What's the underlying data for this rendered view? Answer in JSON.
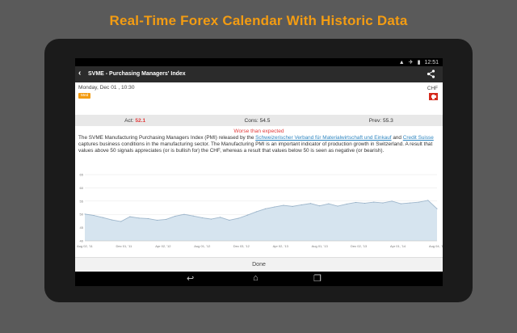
{
  "promo": {
    "title": "Real-Time Forex Calendar With Historic Data"
  },
  "status_bar": {
    "time": "12:51"
  },
  "action_bar": {
    "title": "SVME - Purchasing Managers' Index"
  },
  "event": {
    "date": "Monday, Dec 01 , 10:30",
    "badge": "Med",
    "currency": "CHF",
    "actual_label": "Act:",
    "actual_value": "52.1",
    "consensus_label": "Cons: 54.5",
    "previous_label": "Prev: 55.3",
    "verdict": "Worse than expected",
    "description_pre": "The SVME Manufacturing Purchasing Managers Index (PMI) released by the ",
    "link1": "Schweizerischer Verband für Materialwirtschaft und Einkauf",
    "description_mid": " and ",
    "link2": "Credit Suisse",
    "description_post": " captures business conditions in the manufacturing sector. The Manufacturing PMI is an important indicator of production growth in Switzerland. A result that values above 50 signals appreciates (or is bullish for) the CHF, whereas a result that values below 50 is seen as negative (or bearish)."
  },
  "done_label": "Done",
  "chart_data": {
    "type": "area",
    "x_labels": [
      "Aug 02, '11",
      "Dec 01, '11",
      "Apr 02, '12",
      "Aug 01, '12",
      "Dec 03, '12",
      "Apr 02, '13",
      "Aug 01, '13",
      "Dec 02, '13",
      "Apr 01, '14",
      "Aug 04, '14"
    ],
    "yticks": [
      40,
      45,
      50,
      55,
      60,
      65
    ],
    "ylim": [
      40,
      65
    ],
    "values": [
      50.1,
      49.6,
      48.8,
      47.9,
      47.3,
      49.1,
      48.6,
      48.4,
      47.8,
      48.1,
      49.3,
      50.0,
      49.4,
      48.7,
      48.2,
      48.9,
      47.8,
      48.5,
      49.7,
      51.0,
      52.1,
      52.8,
      53.4,
      53.0,
      53.6,
      54.1,
      53.2,
      54.0,
      53.1,
      53.9,
      54.5,
      54.2,
      54.6,
      54.3,
      55.0,
      54.0,
      54.3,
      54.6,
      55.3,
      52.1
    ]
  }
}
